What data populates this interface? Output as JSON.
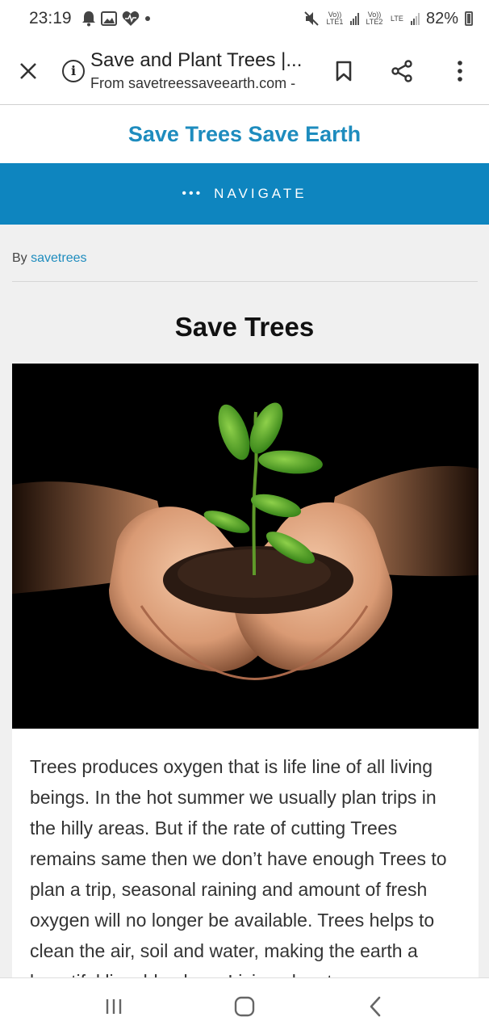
{
  "status_bar": {
    "time": "23:19",
    "sim1_label": "Vo)) LTE1",
    "sim2_label": "Vo)) LTE2",
    "sim2_network": "LTE",
    "battery": "82%"
  },
  "browser": {
    "page_title": "Save and Plant Trees |...",
    "page_source": "From savetreessaveearth.com -"
  },
  "site": {
    "title": "Save Trees Save Earth",
    "nav_dots": "•••",
    "nav_label": "NAVIGATE"
  },
  "post": {
    "by_label": "By",
    "author": "savetrees",
    "title": "Save Trees",
    "body": "Trees produces oxygen that is life line of all living beings. In the hot summer we usually plan trips in the hilly areas. But if the rate of cutting Trees remains same then we don’t have enough Trees to plan a trip, seasonal raining and amount of fresh oxygen will no longer be available. Trees helps to clean the air, soil and water,  making the earth a beautiful liveable place. Living planet"
  },
  "colors": {
    "brand": "#1e8cbe",
    "navbar": "#0e85bf"
  }
}
